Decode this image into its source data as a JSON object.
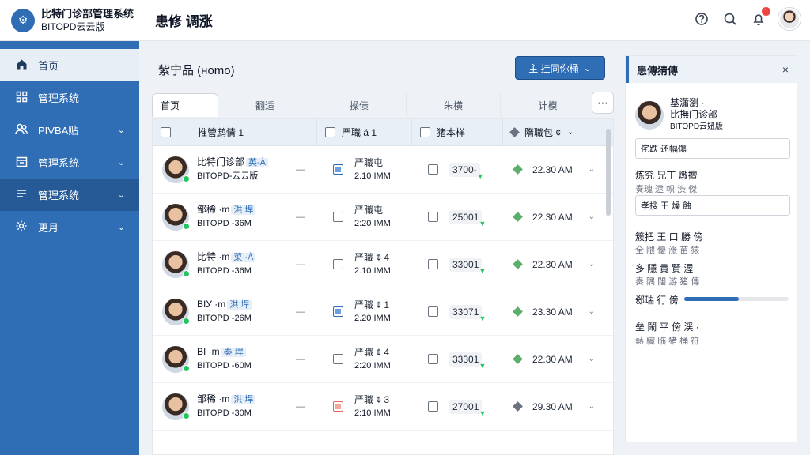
{
  "app": {
    "name_line1": "比特门诊部管理系统",
    "name_line2": "BITOPD云云版",
    "logo_glyph": "⚙",
    "page_heading": "患修 调涨"
  },
  "header": {
    "icons": [
      "help-icon",
      "search-icon",
      "bell-icon"
    ],
    "notification_count": "1"
  },
  "sidebar": {
    "items": [
      {
        "label": "首页",
        "icon": "home-icon",
        "active": true
      },
      {
        "label": "管理系统",
        "icon": "grid-icon"
      },
      {
        "label": "PIVBA贴",
        "icon": "users-icon",
        "chevron": true
      },
      {
        "label": "管理系统",
        "icon": "calendar-icon",
        "chevron": true
      },
      {
        "label": "管理系统",
        "icon": "list-icon",
        "chevron": true,
        "selected": true
      },
      {
        "label": "更月",
        "icon": "gear-icon",
        "chevron": true
      }
    ]
  },
  "main": {
    "title": "紫宁品 (нomo)",
    "primary_button": "主  挂同你桶",
    "tabs": [
      "首页",
      "翻适",
      "操债",
      "朱横",
      "计模"
    ],
    "columns": [
      "推管鹧情 1",
      "严職 á 1",
      "猪本样",
      "隋職包 ¢"
    ],
    "rows": [
      {
        "name": "比特门诊部",
        "tag": "英-À",
        "sub": "BITOPD-云云版",
        "c2a": "严職屯",
        "c2b": "2.10 ІММ",
        "amount": "3700-",
        "time": "22.30 AM",
        "box": "blue",
        "diamond": "green"
      },
      {
        "name": "邹稀 ·m",
        "tag": "洪 垾",
        "sub": "BITOPD -36M",
        "c2a": "严職屯",
        "c2b": "2:20 ІММ",
        "amount": "25001",
        "time": "22.30 AM",
        "box": "plain",
        "diamond": "green"
      },
      {
        "name": "比特 ·m",
        "tag": "菜 ·À",
        "sub": "BITOPD -36M",
        "c2a": "严職 ¢ 4",
        "c2b": "2.10 ІММ",
        "amount": "33001",
        "time": "22.30 AM",
        "box": "plain",
        "diamond": "green"
      },
      {
        "name": "ВІУ ·m",
        "tag": "洪 垾",
        "sub": "BITOPD -26M",
        "c2a": "严職 ¢ 1",
        "c2b": "2.20 ІММ",
        "amount": "33071",
        "time": "23.30 AM",
        "box": "blue",
        "diamond": "green"
      },
      {
        "name": "ВІ ·m",
        "tag": "奏 垾",
        "sub": "BITOPD -60M",
        "c2a": "严職 ¢ 4",
        "c2b": "2:20 ІММ",
        "amount": "33301",
        "time": "22.30 AM",
        "box": "plain",
        "diamond": "green"
      },
      {
        "name": "邹稀 ·m",
        "tag": "洪 垾",
        "sub": "BITOPD -30M",
        "c2a": "严職 ¢ 3",
        "c2b": "2:10 ІММ",
        "amount": "27001",
        "time": "29.30 AM",
        "box": "red",
        "diamond": "gray"
      }
    ]
  },
  "panel": {
    "title": "患傳猜傳",
    "close": "×",
    "profile_line1": "基瀟瀏 ·",
    "profile_line2": "比撫门诊部",
    "profile_line3": "BITOPD云妞版",
    "field1": "侘跌 还幅傷",
    "label1": "炼究  兄丁 燉擅",
    "sub1": "奏瑰 逮 帜 渋 傑",
    "field2": "孝搜 王 燥 蝕",
    "label2": "簇把 王 口 勝 傍",
    "sub2": "全 隈 優 涨 苗 猿",
    "label3": "多 隱 貴 賢 渥",
    "sub3": "奏 隅 闊 游 猪 傳",
    "label4": "郄瑞 行 傍",
    "progress": 0.52,
    "label5": "垒 鬧 平 傍 渓 ·",
    "sub5": "爇 臟 临 猪 桶 符"
  },
  "colors": {
    "accent": "#2f6db5",
    "success": "#22c55e",
    "danger": "#ef4444"
  }
}
